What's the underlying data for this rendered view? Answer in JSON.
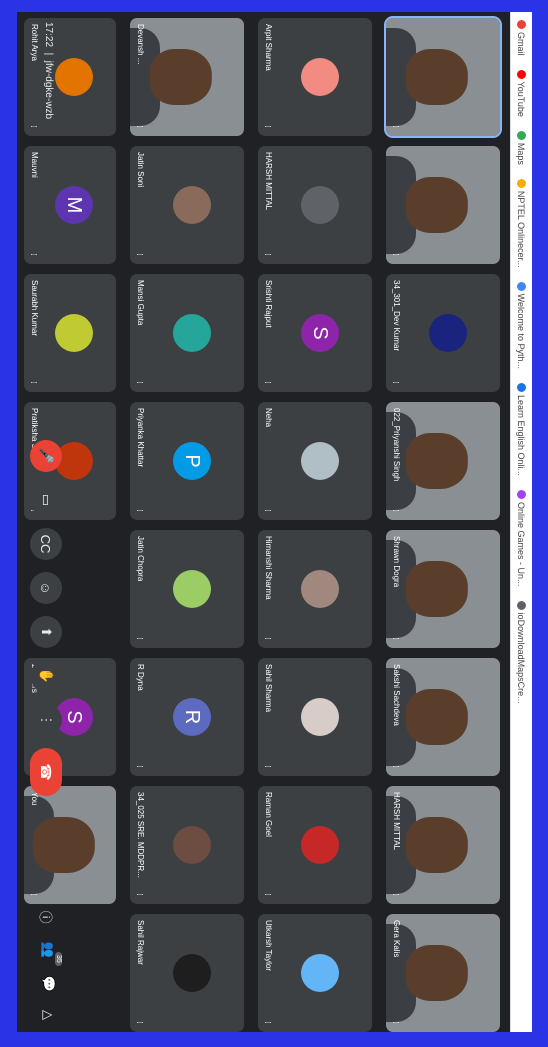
{
  "bookmarks": [
    {
      "label": "Gmail",
      "color": "#ea4335"
    },
    {
      "label": "YouTube",
      "color": "#ff0000"
    },
    {
      "label": "Maps",
      "color": "#34a853"
    },
    {
      "label": "NPTEL Onlinecer...",
      "color": "#f9ab00"
    },
    {
      "label": "Welcome to Pyth...",
      "color": "#4285f4"
    },
    {
      "label": "Learn English Onli...",
      "color": "#1a73e8"
    },
    {
      "label": "Online Games - Un...",
      "color": "#a142f4"
    },
    {
      "label": "ioDownloadMapsCre...",
      "color": "#5f6368"
    }
  ],
  "participants": [
    {
      "name": "",
      "kind": "video",
      "selected": true
    },
    {
      "name": "Arpit Sharma",
      "kind": "avatar",
      "color": "#f28b82",
      "letter": ""
    },
    {
      "name": "Devansh ...",
      "kind": "video"
    },
    {
      "name": "Rohit Arya",
      "kind": "avatar",
      "color": "#e37400",
      "letter": ""
    },
    {
      "name": "",
      "kind": "video"
    },
    {
      "name": "HARSH MITTAL",
      "kind": "avatar",
      "color": "#5f6368",
      "letter": ""
    },
    {
      "name": "Jatin Soni",
      "kind": "avatar",
      "color": "#8a6a5a",
      "letter": ""
    },
    {
      "name": "Mauvni",
      "kind": "avatar",
      "color": "#5e35b1",
      "letter": "M"
    },
    {
      "name": "34_301_Dev Kumar",
      "kind": "avatar",
      "color": "#1a237e",
      "letter": ""
    },
    {
      "name": "Srishti Rajput",
      "kind": "avatar",
      "color": "#8e24aa",
      "letter": "S"
    },
    {
      "name": "Mansi Gupta",
      "kind": "avatar",
      "color": "#26a69a",
      "letter": ""
    },
    {
      "name": "Saurabh Kumar",
      "kind": "avatar",
      "color": "#c0ca33",
      "letter": ""
    },
    {
      "name": "022_Priyanshi Singh",
      "kind": "video"
    },
    {
      "name": "Neha",
      "kind": "avatar",
      "color": "#b0bec5",
      "letter": ""
    },
    {
      "name": "Priyanka Khattar",
      "kind": "avatar",
      "color": "#039be5",
      "letter": "P"
    },
    {
      "name": "Pratiksha Singh",
      "kind": "avatar",
      "color": "#bf360c",
      "letter": ""
    },
    {
      "name": "Shrawn Dogra",
      "kind": "video"
    },
    {
      "name": "Himanshi Sharma",
      "kind": "avatar",
      "color": "#a1887f",
      "letter": ""
    },
    {
      "name": "Jatin Chopra",
      "kind": "avatar",
      "color": "#9ccc65",
      "letter": ""
    },
    {
      "name": "",
      "kind": "empty"
    },
    {
      "name": "Sakshi Sachdeva",
      "kind": "video"
    },
    {
      "name": "Sahil Sharma",
      "kind": "avatar",
      "color": "#d7ccc8",
      "letter": ""
    },
    {
      "name": "R Dyna",
      "kind": "avatar",
      "color": "#5c6bc0",
      "letter": "R"
    },
    {
      "name": "2 others",
      "kind": "avatar",
      "color": "#8e24aa",
      "letter": "S"
    },
    {
      "name": "HARSH MITTAL",
      "kind": "video"
    },
    {
      "name": "Raman Goel",
      "kind": "avatar",
      "color": "#c62828",
      "letter": ""
    },
    {
      "name": "34_025 SRE. MDDPR...",
      "kind": "avatar",
      "color": "#6d4c41",
      "letter": ""
    },
    {
      "name": "You",
      "kind": "video"
    },
    {
      "name": "Gera Kalis",
      "kind": "video"
    },
    {
      "name": "Utkarsh Taylor",
      "kind": "avatar",
      "color": "#64b5f6",
      "letter": ""
    },
    {
      "name": "Sahil Rajwar",
      "kind": "avatar",
      "color": "#1e1e1e",
      "letter": ""
    },
    {
      "name": "",
      "kind": "none"
    }
  ],
  "bottom": {
    "time": "17:22",
    "meeting": "jfw-dgke-wzb",
    "participants_count": "35"
  }
}
